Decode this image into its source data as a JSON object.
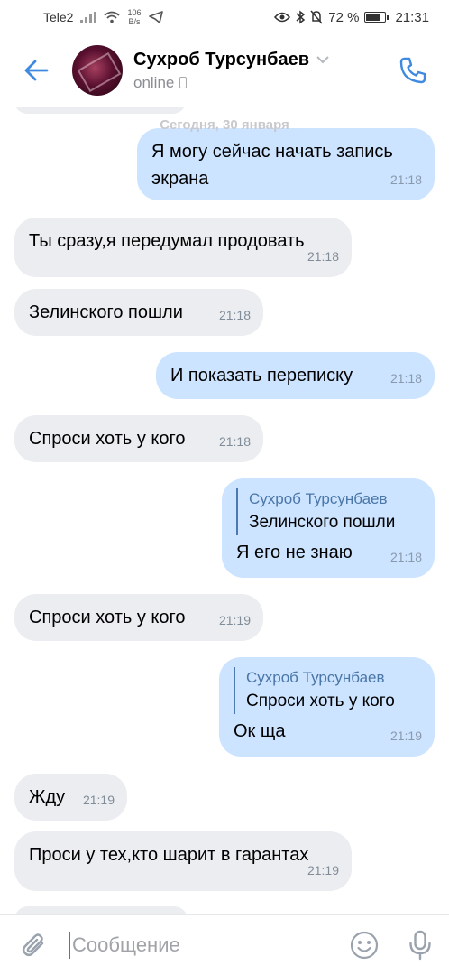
{
  "status_bar": {
    "carrier": "Tele2",
    "speed_value": "106",
    "speed_unit": "B/s",
    "battery_percent": "72 %",
    "battery_level": 0.72,
    "time": "21:31"
  },
  "header": {
    "contact_name": "Сухроб Турсунбаев",
    "status": "online"
  },
  "chat": {
    "date_separator": "Сегодня, 30 января",
    "messages": [
      {
        "direction": "out",
        "text": "Я могу сейчас начать запись экрана",
        "time": "21:18"
      },
      {
        "direction": "in",
        "text": "Ты сразу,я передумал продовать",
        "time": "21:18"
      },
      {
        "direction": "in",
        "text": "Зелинского пошли",
        "time": "21:18"
      },
      {
        "direction": "out",
        "text": "И показать переписку",
        "time": "21:18"
      },
      {
        "direction": "in",
        "text": "Спроси хоть у кого",
        "time": "21:18"
      },
      {
        "direction": "out",
        "reply_author": "Сухроб Турсунбаев",
        "reply_text": "Зелинского пошли",
        "text": "Я его не знаю",
        "time": "21:18"
      },
      {
        "direction": "in",
        "text": "Спроси хоть у кого",
        "time": "21:19"
      },
      {
        "direction": "out",
        "reply_author": "Сухроб Турсунбаев",
        "reply_text": "Спроси хоть у кого",
        "text": "Ок ща",
        "time": "21:19"
      },
      {
        "direction": "in",
        "text": "Жду",
        "time": "21:19"
      },
      {
        "direction": "in",
        "text": "Проси у тех,кто шарит в гарантах",
        "time": "21:19"
      }
    ]
  },
  "input": {
    "placeholder": "Сообщение"
  },
  "colors": {
    "accent": "#3f8ae0",
    "incoming_bubble": "#ebedf0",
    "outgoing_bubble": "#cce4ff",
    "reply_author": "#4a76a8"
  },
  "icons": {
    "back": "arrow-left-icon",
    "call": "phone-icon",
    "attach": "paperclip-icon",
    "emoji": "smile-icon",
    "mic": "microphone-icon"
  }
}
